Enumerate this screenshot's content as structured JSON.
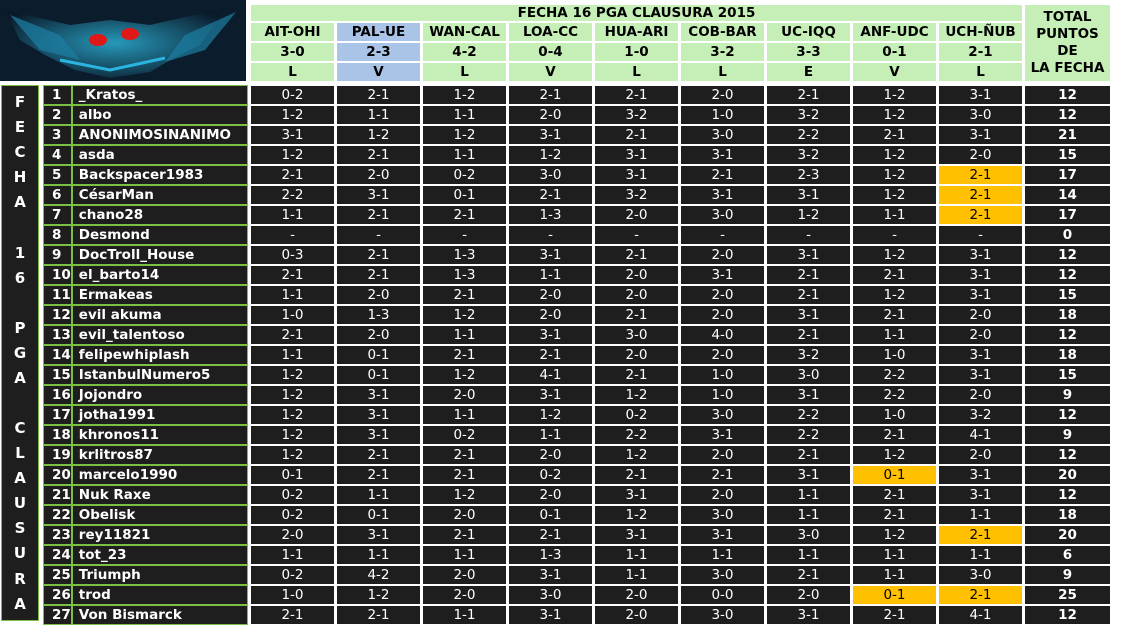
{
  "title": "FECHA 16 PGA CLAUSURA 2015",
  "side_label": [
    "F",
    "E",
    "C",
    "H",
    "A",
    "",
    "1",
    "6",
    "",
    "P",
    "G",
    "A",
    "",
    "C",
    "L",
    "A",
    "U",
    "S",
    "U",
    "R",
    "A"
  ],
  "matches": [
    {
      "teams": "AIT-OHI",
      "score": "3-0",
      "result": "L",
      "highlight": false
    },
    {
      "teams": "PAL-UE",
      "score": "2-3",
      "result": "V",
      "highlight": true
    },
    {
      "teams": "WAN-CAL",
      "score": "4-2",
      "result": "L",
      "highlight": false
    },
    {
      "teams": "LOA-CC",
      "score": "0-4",
      "result": "V",
      "highlight": false
    },
    {
      "teams": "HUA-ARI",
      "score": "1-0",
      "result": "L",
      "highlight": false
    },
    {
      "teams": "COB-BAR",
      "score": "3-2",
      "result": "L",
      "highlight": false
    },
    {
      "teams": "UC-IQQ",
      "score": "3-3",
      "result": "E",
      "highlight": false
    },
    {
      "teams": "ANF-UDC",
      "score": "0-1",
      "result": "V",
      "highlight": false
    },
    {
      "teams": "UCH-ÑUB",
      "score": "2-1",
      "result": "L",
      "highlight": false
    }
  ],
  "total_header": [
    "TOTAL",
    "PUNTOS DE",
    "LA FECHA"
  ],
  "players": [
    {
      "n": "1",
      "name": "_Kratos_",
      "p": [
        "0-2",
        "2-1",
        "1-2",
        "2-1",
        "2-1",
        "2-0",
        "2-1",
        "1-2",
        "3-1"
      ],
      "t": "12"
    },
    {
      "n": "2",
      "name": "albo",
      "p": [
        "1-2",
        "1-1",
        "1-1",
        "2-0",
        "3-2",
        "1-0",
        "3-2",
        "1-2",
        "3-0"
      ],
      "t": "12"
    },
    {
      "n": "3",
      "name": "ANONIMOSINANIMO",
      "p": [
        "3-1",
        "1-2",
        "1-2",
        "3-1",
        "2-1",
        "3-0",
        "2-2",
        "2-1",
        "3-1"
      ],
      "t": "21"
    },
    {
      "n": "4",
      "name": "asda",
      "p": [
        "1-2",
        "2-1",
        "1-1",
        "1-2",
        "3-1",
        "3-1",
        "3-2",
        "1-2",
        "2-0"
      ],
      "t": "15"
    },
    {
      "n": "5",
      "name": "Backspacer1983",
      "p": [
        "2-1",
        "2-0",
        "0-2",
        "3-0",
        "3-1",
        "2-1",
        "2-3",
        "1-2",
        "2-1"
      ],
      "t": "17"
    },
    {
      "n": "6",
      "name": "CésarMan",
      "p": [
        "2-2",
        "3-1",
        "0-1",
        "2-1",
        "3-2",
        "3-1",
        "3-1",
        "1-2",
        "2-1"
      ],
      "t": "14"
    },
    {
      "n": "7",
      "name": "chano28",
      "p": [
        "1-1",
        "2-1",
        "2-1",
        "1-3",
        "2-0",
        "3-0",
        "1-2",
        "1-1",
        "2-1"
      ],
      "t": "17"
    },
    {
      "n": "8",
      "name": "Desmond",
      "p": [
        "-",
        "-",
        "-",
        "-",
        "-",
        "-",
        "-",
        "-",
        "-"
      ],
      "t": "0"
    },
    {
      "n": "9",
      "name": "DocTroll_House",
      "p": [
        "0-3",
        "2-1",
        "1-3",
        "3-1",
        "2-1",
        "2-0",
        "3-1",
        "1-2",
        "3-1"
      ],
      "t": "12"
    },
    {
      "n": "10",
      "name": "el_barto14",
      "p": [
        "2-1",
        "2-1",
        "1-3",
        "1-1",
        "2-0",
        "3-1",
        "2-1",
        "2-1",
        "3-1"
      ],
      "t": "12"
    },
    {
      "n": "11",
      "name": "Ermakeas",
      "p": [
        "1-1",
        "2-0",
        "2-1",
        "2-0",
        "2-0",
        "2-0",
        "2-1",
        "1-2",
        "3-1"
      ],
      "t": "15"
    },
    {
      "n": "12",
      "name": "evil akuma",
      "p": [
        "1-0",
        "1-3",
        "1-2",
        "2-0",
        "2-1",
        "2-0",
        "3-1",
        "2-1",
        "2-0"
      ],
      "t": "18"
    },
    {
      "n": "13",
      "name": "evil_talentoso",
      "p": [
        "2-1",
        "2-0",
        "1-1",
        "3-1",
        "3-0",
        "4-0",
        "2-1",
        "1-1",
        "2-0"
      ],
      "t": "12"
    },
    {
      "n": "14",
      "name": "felipewhiplash",
      "p": [
        "1-1",
        "0-1",
        "2-1",
        "2-1",
        "2-0",
        "2-0",
        "3-2",
        "1-0",
        "3-1"
      ],
      "t": "18"
    },
    {
      "n": "15",
      "name": "IstanbulNumero5",
      "p": [
        "1-2",
        "0-1",
        "1-2",
        "4-1",
        "2-1",
        "1-0",
        "3-0",
        "2-2",
        "3-1"
      ],
      "t": "15"
    },
    {
      "n": "16",
      "name": "Jojondro",
      "p": [
        "1-2",
        "3-1",
        "2-0",
        "3-1",
        "1-2",
        "1-0",
        "3-1",
        "2-2",
        "2-0"
      ],
      "t": "9"
    },
    {
      "n": "17",
      "name": "jotha1991",
      "p": [
        "1-2",
        "3-1",
        "1-1",
        "1-2",
        "0-2",
        "3-0",
        "2-2",
        "1-0",
        "3-2"
      ],
      "t": "12"
    },
    {
      "n": "18",
      "name": "khronos11",
      "p": [
        "1-2",
        "3-1",
        "0-2",
        "1-1",
        "2-2",
        "3-1",
        "2-2",
        "2-1",
        "4-1"
      ],
      "t": "9"
    },
    {
      "n": "19",
      "name": "krlitros87",
      "p": [
        "1-2",
        "2-1",
        "2-1",
        "2-0",
        "1-2",
        "2-0",
        "2-1",
        "1-2",
        "2-0"
      ],
      "t": "12"
    },
    {
      "n": "20",
      "name": "marcelo1990",
      "p": [
        "0-1",
        "2-1",
        "2-1",
        "0-2",
        "2-1",
        "2-1",
        "3-1",
        "0-1",
        "3-1"
      ],
      "t": "20"
    },
    {
      "n": "21",
      "name": "Nuk Raxe",
      "p": [
        "0-2",
        "1-1",
        "1-2",
        "2-0",
        "3-1",
        "2-0",
        "1-1",
        "2-1",
        "3-1"
      ],
      "t": "12"
    },
    {
      "n": "22",
      "name": "Obelisk",
      "p": [
        "0-2",
        "0-1",
        "2-0",
        "0-1",
        "1-2",
        "3-0",
        "1-1",
        "2-1",
        "1-1"
      ],
      "t": "18"
    },
    {
      "n": "23",
      "name": "rey11821",
      "p": [
        "2-0",
        "3-1",
        "2-1",
        "2-1",
        "3-1",
        "3-1",
        "3-0",
        "1-2",
        "2-1"
      ],
      "t": "20"
    },
    {
      "n": "24",
      "name": "tot_23",
      "p": [
        "1-1",
        "1-1",
        "1-1",
        "1-3",
        "1-1",
        "1-1",
        "1-1",
        "1-1",
        "1-1"
      ],
      "t": "6"
    },
    {
      "n": "25",
      "name": "Triumph",
      "p": [
        "0-2",
        "4-2",
        "2-0",
        "3-1",
        "1-1",
        "3-0",
        "2-1",
        "1-1",
        "3-0"
      ],
      "t": "9"
    },
    {
      "n": "26",
      "name": "trod",
      "p": [
        "1-0",
        "1-2",
        "2-0",
        "3-0",
        "2-0",
        "0-0",
        "2-0",
        "0-1",
        "2-1"
      ],
      "t": "25"
    },
    {
      "n": "27",
      "name": "Von Bismarck",
      "p": [
        "2-1",
        "2-1",
        "1-1",
        "3-1",
        "2-0",
        "3-0",
        "3-1",
        "2-1",
        "4-1"
      ],
      "t": "12"
    }
  ],
  "highlights": [
    {
      "row": 4,
      "col": 8
    },
    {
      "row": 5,
      "col": 8
    },
    {
      "row": 6,
      "col": 8
    },
    {
      "row": 19,
      "col": 7
    },
    {
      "row": 22,
      "col": 8
    },
    {
      "row": 25,
      "col": 7
    },
    {
      "row": 25,
      "col": 8
    }
  ],
  "colors": {
    "highlight": "#ffc000",
    "header_green": "#c6efb7",
    "header_blue": "#a9c4e6",
    "cell_dark": "#1e1e1e",
    "border_green": "#7bc043"
  }
}
